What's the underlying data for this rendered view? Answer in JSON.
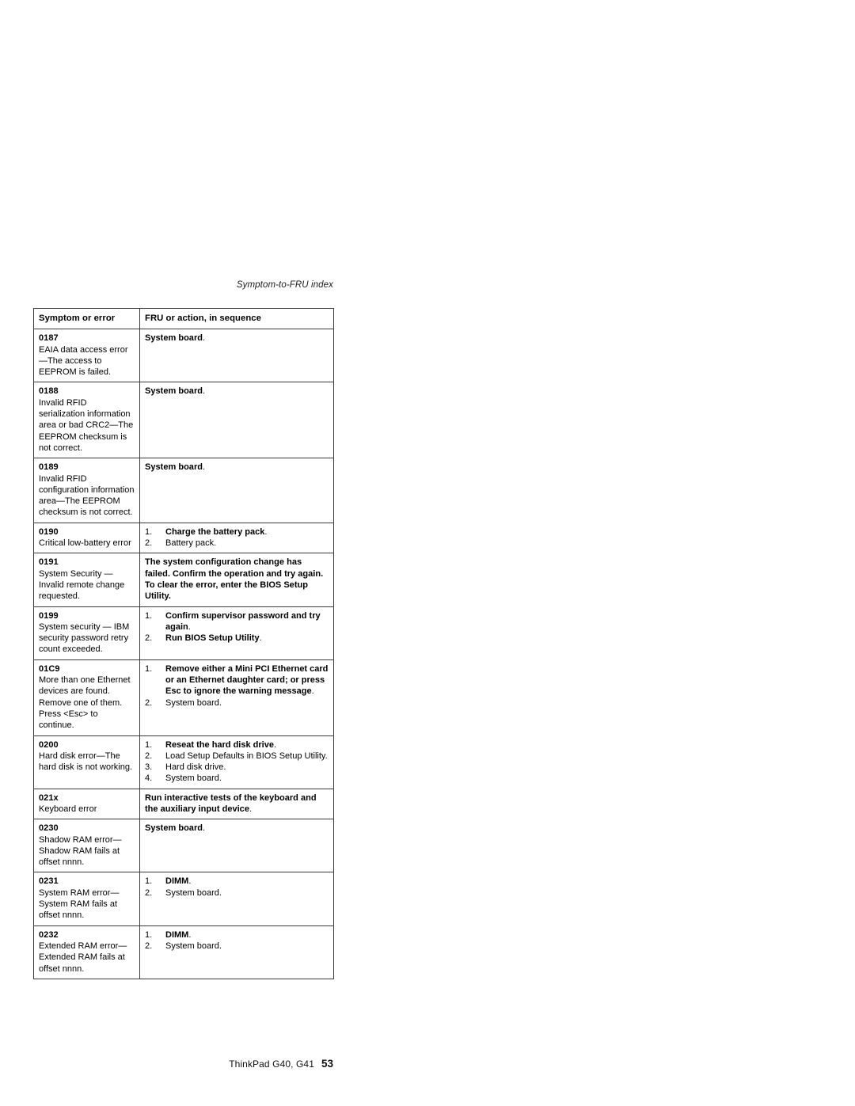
{
  "document": {
    "running_head": "Symptom-to-FRU index",
    "footer": {
      "book_title": "ThinkPad G40, G41",
      "page_number": "53"
    }
  },
  "table": {
    "headers": {
      "symptom": "Symptom or error",
      "action": "FRU or action, in sequence"
    },
    "rows": [
      {
        "code": "0187",
        "description": "EAIA data access error—The access to EEPROM is failed.",
        "action_type": "text",
        "action_text": "System board",
        "action_period": "."
      },
      {
        "code": "0188",
        "description": "Invalid RFID serialization information area or bad CRC2—The EEPROM checksum is not correct.",
        "action_type": "text",
        "action_text": "System board",
        "action_period": "."
      },
      {
        "code": "0189",
        "description": "Invalid RFID configuration information area—The EEPROM checksum is not correct.",
        "action_type": "text",
        "action_text": "System board",
        "action_period": "."
      },
      {
        "code": "0190",
        "description": "Critical low-battery error",
        "action_type": "list",
        "steps": [
          {
            "num": "1.",
            "text": "Charge the battery pack",
            "period": ".",
            "bold": true
          },
          {
            "num": "2.",
            "text": "Battery pack.",
            "period": "",
            "bold": false
          }
        ]
      },
      {
        "code": "0191",
        "description": "System Security — Invalid remote change requested.",
        "action_type": "text",
        "action_text": "The system configuration change has failed. Confirm the operation and try again. To clear the error, enter the BIOS Setup Utility.",
        "action_period": ""
      },
      {
        "code": "0199",
        "description": "System security — IBM security password retry count exceeded.",
        "action_type": "list",
        "steps": [
          {
            "num": "1.",
            "text": "Confirm supervisor password and try again",
            "period": ".",
            "bold": true
          },
          {
            "num": "2.",
            "text": "Run BIOS Setup Utility",
            "period": ".",
            "bold": true
          }
        ]
      },
      {
        "code": "01C9",
        "description": "More than one Ethernet devices are found. Remove one of them. Press <Esc> to continue.",
        "action_type": "list",
        "steps": [
          {
            "num": "1.",
            "text": "Remove either a Mini PCI Ethernet card or an Ethernet daughter card; or press Esc to ignore the warning message",
            "period": ".",
            "bold": true
          },
          {
            "num": "2.",
            "text": "System board.",
            "period": "",
            "bold": false
          }
        ]
      },
      {
        "code": "0200",
        "description": "Hard disk error—The hard disk is not working.",
        "action_type": "list",
        "steps": [
          {
            "num": "1.",
            "text": "Reseat the hard disk drive",
            "period": ".",
            "bold": true
          },
          {
            "num": "2.",
            "text": "Load Setup Defaults in BIOS Setup Utility.",
            "period": "",
            "bold": false
          },
          {
            "num": "3.",
            "text": "Hard disk drive.",
            "period": "",
            "bold": false
          },
          {
            "num": "4.",
            "text": "System board.",
            "period": "",
            "bold": false
          }
        ]
      },
      {
        "code": "021x",
        "description": "Keyboard error",
        "action_type": "text",
        "action_text": "Run interactive tests of the keyboard and the auxiliary input device",
        "action_period": "."
      },
      {
        "code": "0230",
        "description": "Shadow RAM error—Shadow RAM fails at offset nnnn.",
        "action_type": "text",
        "action_text": "System board",
        "action_period": "."
      },
      {
        "code": "0231",
        "description": "System RAM error—System RAM fails at offset nnnn.",
        "action_type": "list",
        "steps": [
          {
            "num": "1.",
            "text": "DIMM",
            "period": ".",
            "bold": true
          },
          {
            "num": "2.",
            "text": "System board.",
            "period": "",
            "bold": false
          }
        ]
      },
      {
        "code": "0232",
        "description": "Extended RAM error—Extended RAM fails at offset nnnn.",
        "action_type": "list",
        "steps": [
          {
            "num": "1.",
            "text": "DIMM",
            "period": ".",
            "bold": true
          },
          {
            "num": "2.",
            "text": "System board.",
            "period": "",
            "bold": false
          }
        ]
      }
    ]
  }
}
